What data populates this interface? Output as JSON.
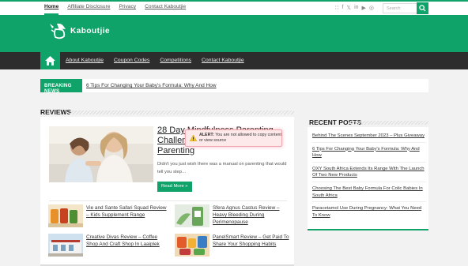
{
  "topnav": {
    "items": [
      "Home",
      "Affiliate Disclosure",
      "Privacy",
      "Contact Kaboutjie"
    ],
    "active": "Home"
  },
  "social_icons": [
    "rss-icon",
    "facebook-icon",
    "twitter-icon",
    "linkedin-icon",
    "youtube-icon",
    "instagram-icon"
  ],
  "search": {
    "placeholder": "Search"
  },
  "logo": {
    "text": "Kaboutjie"
  },
  "mainnav": {
    "items": [
      "About Kaboutjie",
      "Coupon Codes",
      "Competitions",
      "Contact Kaboutjie"
    ]
  },
  "breaking": {
    "label": "BREAKING NEWS",
    "headline": "6 Tips For Changing Your Baby's Formula: Why And How"
  },
  "reviews": {
    "heading": "REVIEWS",
    "featured": {
      "title": "28 Day Mindfulness Parenting Challenge – Simplifying Parenting",
      "excerpt": "Didn't you just wish there was a manual on parenting that would tell you step…",
      "button": "Read More »"
    },
    "items": [
      {
        "title": "Vie and Sante Safari Squad Review – Kids Supplement Range"
      },
      {
        "title": "Sfera Agnus Castus Review – Heavy Bleeding During Perimenopause"
      },
      {
        "title": "Creative Divas Review – Coffee Shop And Craft Shop In Laaiplek"
      },
      {
        "title": "PanelSmart Review – Get Paid To Share Your Shopping Habits"
      }
    ]
  },
  "recent": {
    "heading": "RECENT POSTS",
    "items": [
      "Behind The Scenes September 2023 – Plus Giveaway",
      "6 Tips For Changing Your Baby's Formula: Why And How",
      "OXY South Africa Extends Its Range With The Launch Of Two New Products",
      "Choosing The Best Baby Formula For Colic Babies In South Africa",
      "Paracetamol Use During Pregnancy: What You Need To Know"
    ]
  },
  "alert": {
    "label": "ALERT:",
    "message": "You are not allowed to copy content or view source"
  },
  "colors": {
    "brand": "#0fa36a",
    "nav": "#2d2d2d",
    "alert_bg": "#fde8ea"
  }
}
